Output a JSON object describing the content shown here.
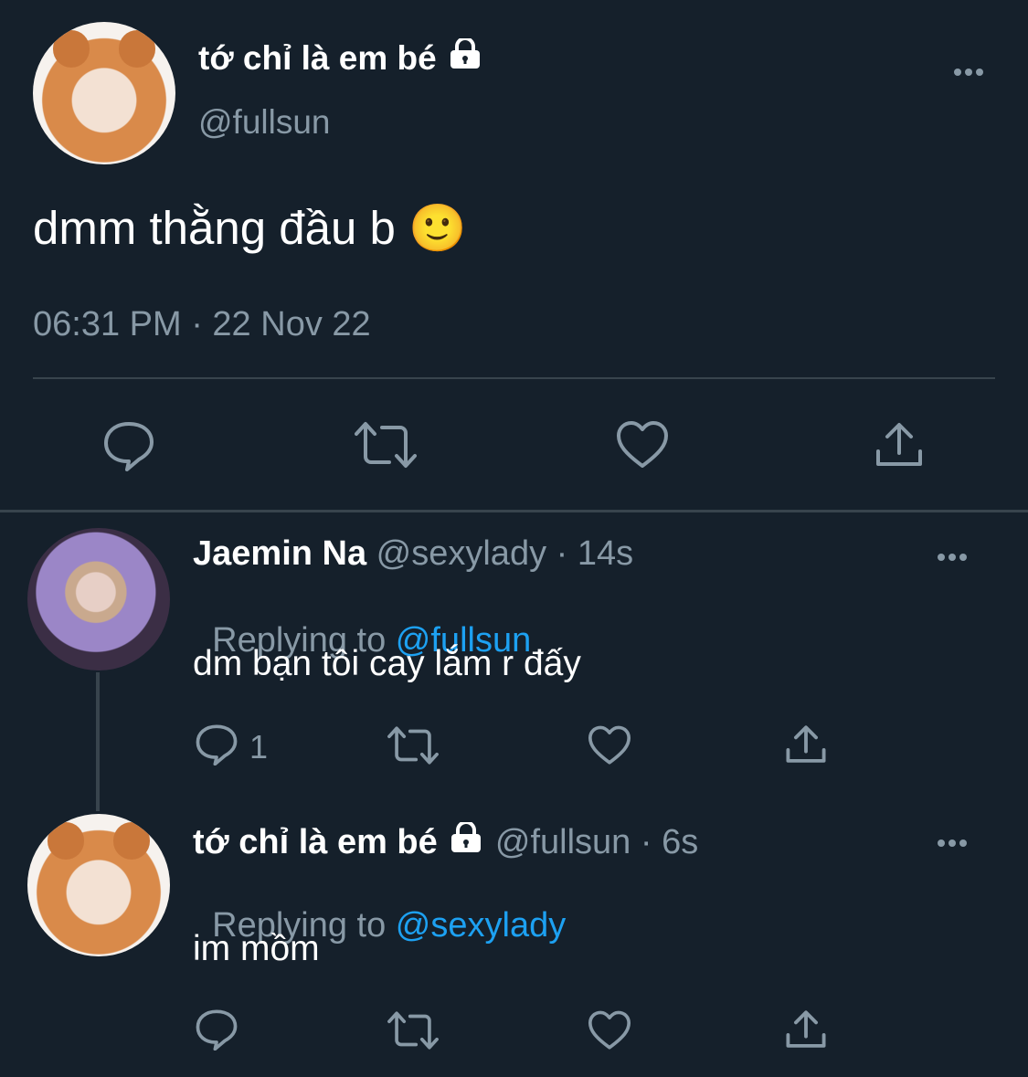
{
  "main_tweet": {
    "display_name": "tớ chỉ là em bé",
    "handle": "@fullsun",
    "text": "dmm thằng đầu b 🙂",
    "timestamp": "06:31 PM · 22 Nov 22",
    "icons": [
      "reply-icon",
      "retweet-icon",
      "like-icon",
      "share-icon",
      "more-icon",
      "lock-icon"
    ]
  },
  "replies": [
    {
      "display_name": "Jaemin Na",
      "meta": "@sexylady · 14s",
      "replying_prefix": "Replying to ",
      "replying_to": "@fullsun",
      "text": "dm bạn tôi cay lắm r đấy",
      "reply_count": "1"
    },
    {
      "display_name": "tớ chỉ là em bé",
      "meta": "@fullsun · 6s",
      "replying_prefix": "Replying to ",
      "replying_to": "@sexylady",
      "text": "im mồm",
      "reply_count": ""
    }
  ],
  "colors": {
    "background": "#15202b",
    "muted": "#8899a6",
    "accent": "#1da1f2",
    "divider": "#38444d"
  }
}
